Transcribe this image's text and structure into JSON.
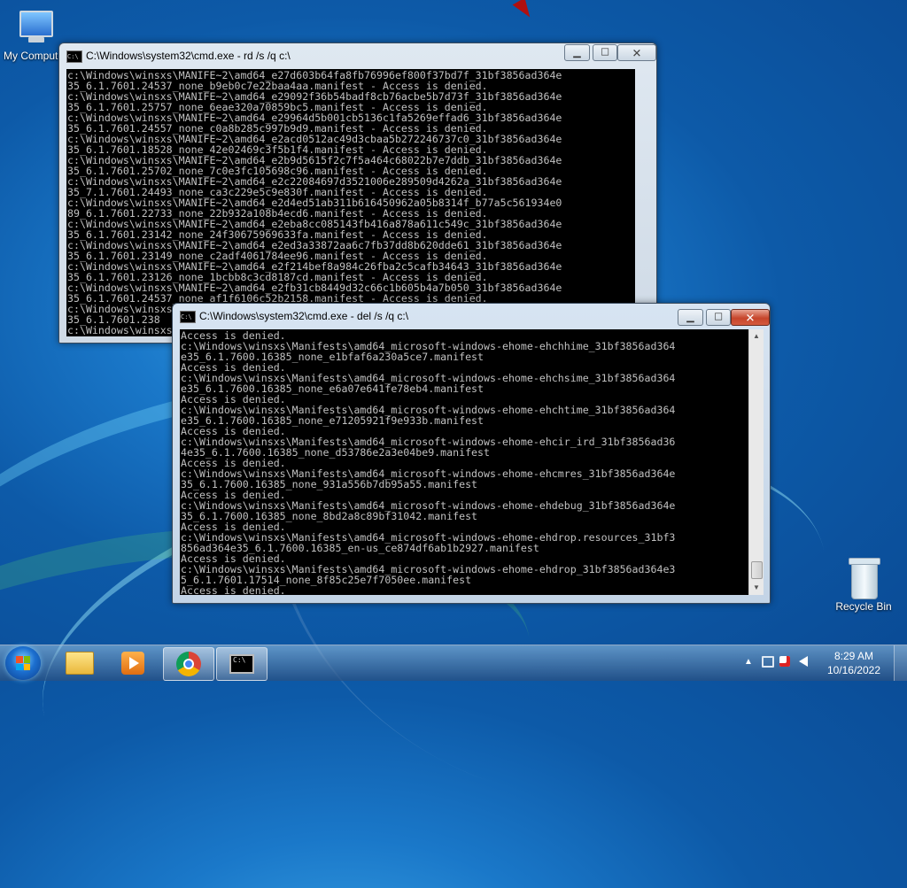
{
  "desktop": {
    "icons": [
      {
        "label": "My Computer",
        "icon": "computer-icon"
      },
      {
        "label": "Recycle Bin",
        "icon": "recycle-bin-icon"
      }
    ]
  },
  "window_rd": {
    "title": "C:\\Windows\\system32\\cmd.exe - rd  /s /q c:\\",
    "icon": "cmd-icon",
    "icon_text": "C:\\",
    "state": "inactive",
    "output": "c:\\Windows\\winsxs\\MANIFE~2\\amd64_e27d603b64fa8fb76996ef800f37bd7f_31bf3856ad364e\n35_6.1.7601.24537_none_b9eb0c7e22baa4aa.manifest - Access is denied.\nc:\\Windows\\winsxs\\MANIFE~2\\amd64_e29092f36b54badf8cb76acbe5b7d73f_31bf3856ad364e\n35_6.1.7601.25757_none_6eae320a70859bc5.manifest - Access is denied.\nc:\\Windows\\winsxs\\MANIFE~2\\amd64_e29964d5b001cb5136c1fa5269effad6_31bf3856ad364e\n35_6.1.7601.24557_none_c0a8b285c997b9d9.manifest - Access is denied.\nc:\\Windows\\winsxs\\MANIFE~2\\amd64_e2acd0512ac49d3cbaa5b272246737c0_31bf3856ad364e\n35_6.1.7601.18528_none_42e02469c3f5b1f4.manifest - Access is denied.\nc:\\Windows\\winsxs\\MANIFE~2\\amd64_e2b9d5615f2c7f5a464c68022b7e7ddb_31bf3856ad364e\n35_6.1.7601.25702_none_7c0e3fc105698c96.manifest - Access is denied.\nc:\\Windows\\winsxs\\MANIFE~2\\amd64_e2c22084697d3521006e289509d4262a_31bf3856ad364e\n35_7.1.7601.24493_none_ca3c229e5c9e830f.manifest - Access is denied.\nc:\\Windows\\winsxs\\MANIFE~2\\amd64_e2d4ed51ab311b616450962a05b8314f_b77a5c561934e0\n89_6.1.7601.22733_none_22b932a108b4ecd6.manifest - Access is denied.\nc:\\Windows\\winsxs\\MANIFE~2\\amd64_e2eba8cc085143fb416a878a611c549c_31bf3856ad364e\n35_6.1.7601.23142_none_24f30675969633fa.manifest - Access is denied.\nc:\\Windows\\winsxs\\MANIFE~2\\amd64_e2ed3a33872aa6c7fb37dd8b620dde61_31bf3856ad364e\n35_6.1.7601.23149_none_c2adf4061784ee96.manifest - Access is denied.\nc:\\Windows\\winsxs\\MANIFE~2\\amd64_e2f214bef8a984c26fba2c5cafb34643_31bf3856ad364e\n35_6.1.7601.23126_none_1bcbb8c3cd8187cd.manifest - Access is denied.\nc:\\Windows\\winsxs\\MANIFE~2\\amd64_e2fb31cb8449d32c66c1b605b4a7b050_31bf3856ad364e\n35_6.1.7601.24537_none_af1f6106c52b2158.manifest - Access is denied.\nc:\\Windows\\winsxs\\MANIFE~2\\amd64_e3\n35_6.1.7601.238\nc:\\Windows\\winsxs"
  },
  "window_del": {
    "title": "C:\\Windows\\system32\\cmd.exe - del  /s /q c:\\",
    "icon": "cmd-icon",
    "icon_text": "C:\\",
    "state": "active",
    "output": "Access is denied.\nc:\\Windows\\winsxs\\Manifests\\amd64_microsoft-windows-ehome-ehchhime_31bf3856ad364\ne35_6.1.7600.16385_none_e1bfaf6a230a5ce7.manifest\nAccess is denied.\nc:\\Windows\\winsxs\\Manifests\\amd64_microsoft-windows-ehome-ehchsime_31bf3856ad364\ne35_6.1.7600.16385_none_e6a07e641fe78eb4.manifest\nAccess is denied.\nc:\\Windows\\winsxs\\Manifests\\amd64_microsoft-windows-ehome-ehchtime_31bf3856ad364\ne35_6.1.7600.16385_none_e71205921f9e933b.manifest\nAccess is denied.\nc:\\Windows\\winsxs\\Manifests\\amd64_microsoft-windows-ehome-ehcir_ird_31bf3856ad36\n4e35_6.1.7600.16385_none_d53786e2a3e04be9.manifest\nAccess is denied.\nc:\\Windows\\winsxs\\Manifests\\amd64_microsoft-windows-ehome-ehcmres_31bf3856ad364e\n35_6.1.7600.16385_none_931a556b7db95a55.manifest\nAccess is denied.\nc:\\Windows\\winsxs\\Manifests\\amd64_microsoft-windows-ehome-ehdebug_31bf3856ad364e\n35_6.1.7600.16385_none_8bd2a8c89bf31042.manifest\nAccess is denied.\nc:\\Windows\\winsxs\\Manifests\\amd64_microsoft-windows-ehome-ehdrop.resources_31bf3\n856ad364e35_6.1.7600.16385_en-us_ce874df6ab1b2927.manifest\nAccess is denied.\nc:\\Windows\\winsxs\\Manifests\\amd64_microsoft-windows-ehome-ehdrop_31bf3856ad364e3\n5_6.1.7601.17514_none_8f85c25e7f7050ee.manifest\nAccess is denied."
  },
  "window_controls": {
    "minimize": "▁",
    "maximize": "☐",
    "close": "✕"
  },
  "taskbar": {
    "start_icon": "windows-flag-icon",
    "pinned": [
      {
        "name": "folder-icon"
      },
      {
        "name": "media-player-icon"
      },
      {
        "name": "chrome-icon"
      },
      {
        "name": "cmd-icon",
        "active": true,
        "icon_text": "C:\\"
      }
    ],
    "tray": {
      "overflow": "▲",
      "icons": [
        "network-icon",
        "action-center-icon",
        "volume-icon"
      ],
      "time": "8:29 AM",
      "date": "10/16/2022"
    }
  },
  "colors": {
    "console_bg": "#000000",
    "console_text": "#c0c0c0",
    "close_button": "#c6452b",
    "taskbar": "#2a5080"
  }
}
